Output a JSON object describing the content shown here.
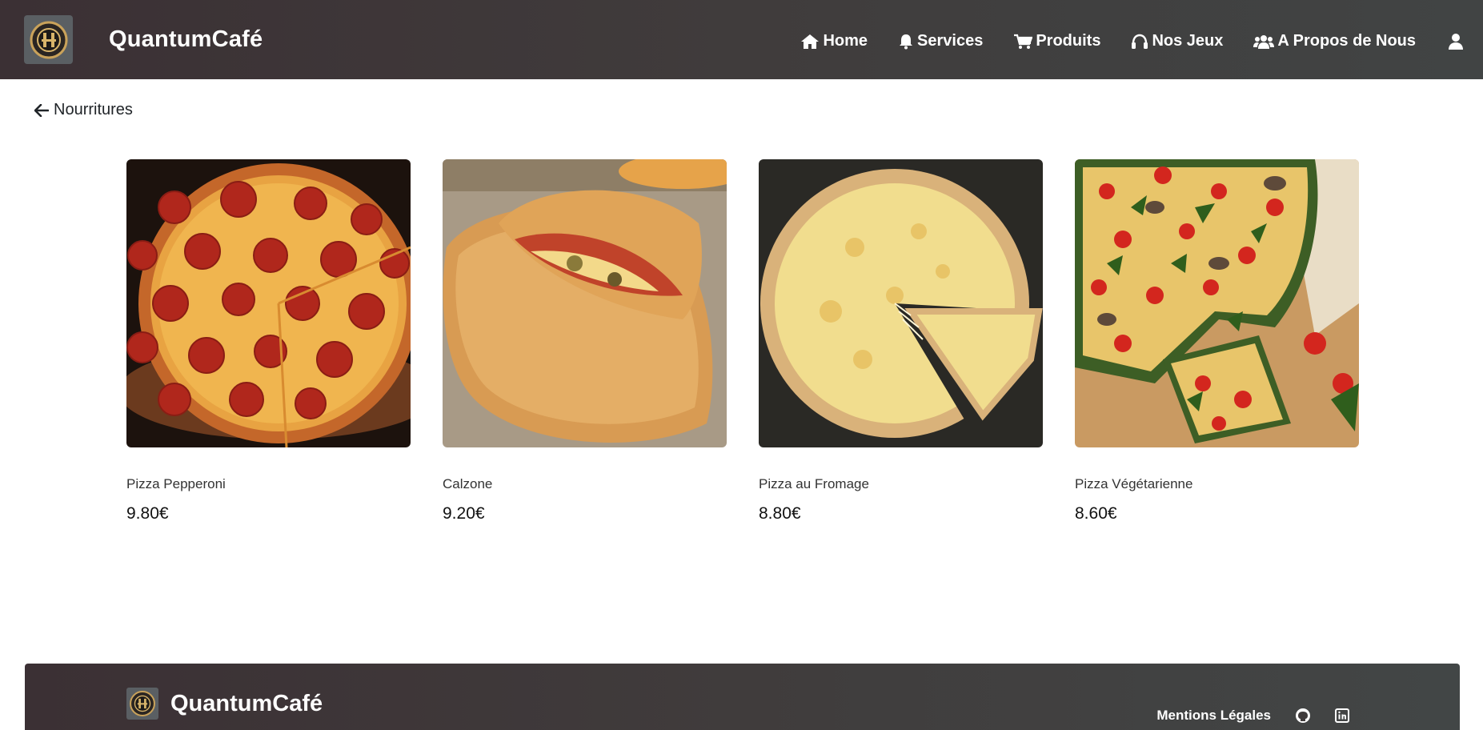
{
  "navbar": {
    "brand": "QuantumCafé",
    "links": [
      {
        "label": "Home",
        "icon": "home-icon"
      },
      {
        "label": "Services",
        "icon": "bell-icon"
      },
      {
        "label": "Produits",
        "icon": "cart-icon"
      },
      {
        "label": "Nos Jeux",
        "icon": "headphones-icon"
      },
      {
        "label": "A Propos de Nous",
        "icon": "users-icon"
      }
    ],
    "user_icon": "user-icon"
  },
  "back": {
    "label": "Nourritures",
    "icon": "arrow-left-icon"
  },
  "products": [
    {
      "name": "Pizza Pepperoni",
      "price": "9.80€"
    },
    {
      "name": "Calzone",
      "price": "9.20€"
    },
    {
      "name": "Pizza au Fromage",
      "price": "8.80€"
    },
    {
      "name": "Pizza Végétarienne",
      "price": "8.60€"
    }
  ],
  "footer": {
    "brand": "QuantumCafé",
    "legal": "Mentions Légales",
    "icons": [
      "github-icon",
      "linkedin-icon"
    ]
  },
  "colors": {
    "navbar_start": "#3b3034",
    "navbar_end": "#414444",
    "text": "#212529"
  }
}
